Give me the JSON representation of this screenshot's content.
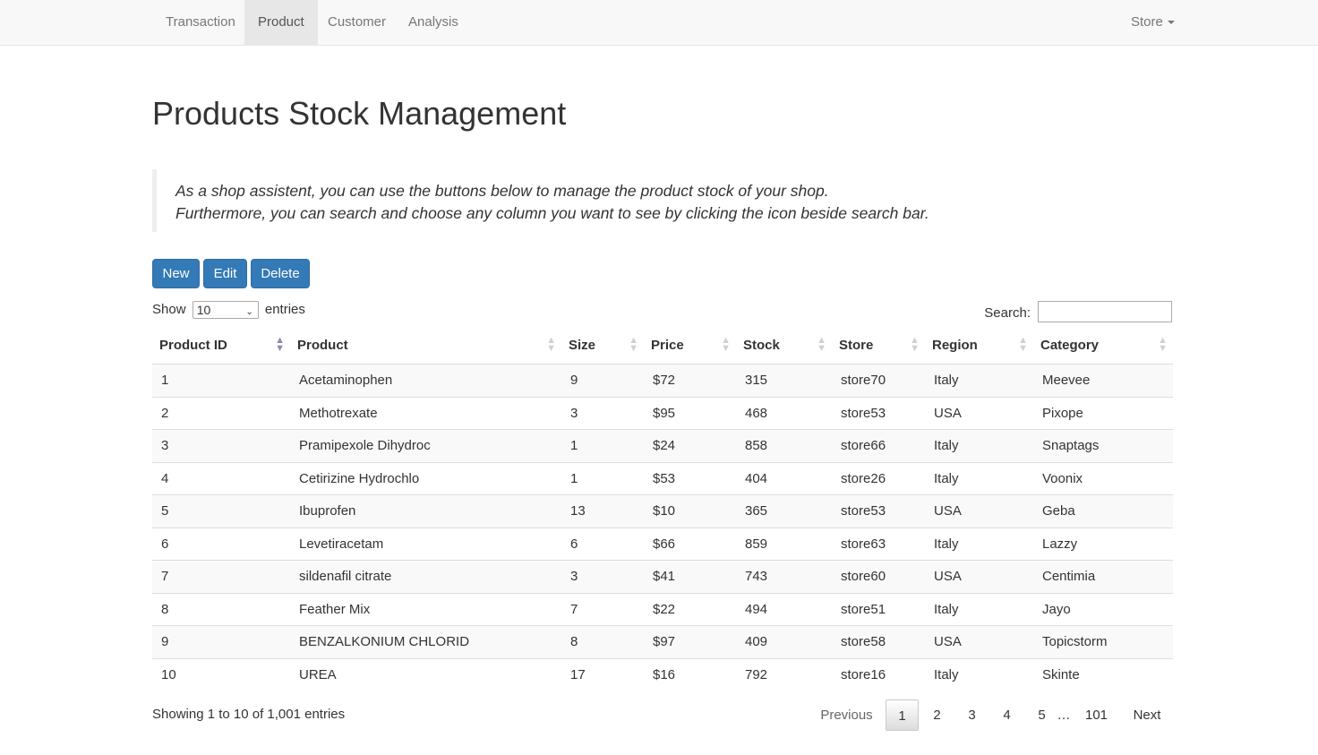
{
  "nav": {
    "items": [
      {
        "label": "Transaction",
        "active": false
      },
      {
        "label": "Product",
        "active": true
      },
      {
        "label": "Customer",
        "active": false
      },
      {
        "label": "Analysis",
        "active": false
      }
    ],
    "store_label": "Store"
  },
  "page": {
    "title": "Products Stock Management",
    "description_line1": "As a shop assistent, you can use the buttons below to manage the product stock of your shop.",
    "description_line2": "Furthermore, you can search and choose any column you want to see by clicking the icon beside search bar."
  },
  "actions": {
    "new_label": "New",
    "edit_label": "Edit",
    "delete_label": "Delete"
  },
  "length": {
    "show_label": "Show",
    "value": "10",
    "entries_label": "entries"
  },
  "search": {
    "label": "Search:",
    "value": ""
  },
  "table": {
    "columns": [
      "Product ID",
      "Product",
      "Size",
      "Price",
      "Stock",
      "Store",
      "Region",
      "Category"
    ],
    "sorted_column": "Product ID",
    "rows": [
      [
        "1",
        "Acetaminophen",
        "9",
        "$72",
        "315",
        "store70",
        "Italy",
        "Meevee"
      ],
      [
        "2",
        "Methotrexate",
        "3",
        "$95",
        "468",
        "store53",
        "USA",
        "Pixope"
      ],
      [
        "3",
        "Pramipexole Dihydroc",
        "1",
        "$24",
        "858",
        "store66",
        "Italy",
        "Snaptags"
      ],
      [
        "4",
        "Cetirizine Hydrochlo",
        "1",
        "$53",
        "404",
        "store26",
        "Italy",
        "Voonix"
      ],
      [
        "5",
        "Ibuprofen",
        "13",
        "$10",
        "365",
        "store53",
        "USA",
        "Geba"
      ],
      [
        "6",
        "Levetiracetam",
        "6",
        "$66",
        "859",
        "store63",
        "Italy",
        "Lazzy"
      ],
      [
        "7",
        "sildenafil citrate",
        "3",
        "$41",
        "743",
        "store60",
        "USA",
        "Centimia"
      ],
      [
        "8",
        "Feather Mix",
        "7",
        "$22",
        "494",
        "store51",
        "Italy",
        "Jayo"
      ],
      [
        "9",
        "BENZALKONIUM CHLORID",
        "8",
        "$97",
        "409",
        "store58",
        "USA",
        "Topicstorm"
      ],
      [
        "10",
        "UREA",
        "17",
        "$16",
        "792",
        "store16",
        "Italy",
        "Skinte"
      ]
    ]
  },
  "footer": {
    "info": "Showing 1 to 10 of 1,001 entries"
  },
  "pagination": {
    "previous": "Previous",
    "pages": [
      "1",
      "2",
      "3",
      "4",
      "5"
    ],
    "current": "1",
    "ellipsis": "…",
    "last": "101",
    "next": "Next"
  },
  "colors": {
    "primary_button": "#337ab7",
    "navbar_bg": "#f8f8f8",
    "active_nav_bg": "#e7e7e7",
    "stripe_row": "#f9f9f9"
  }
}
